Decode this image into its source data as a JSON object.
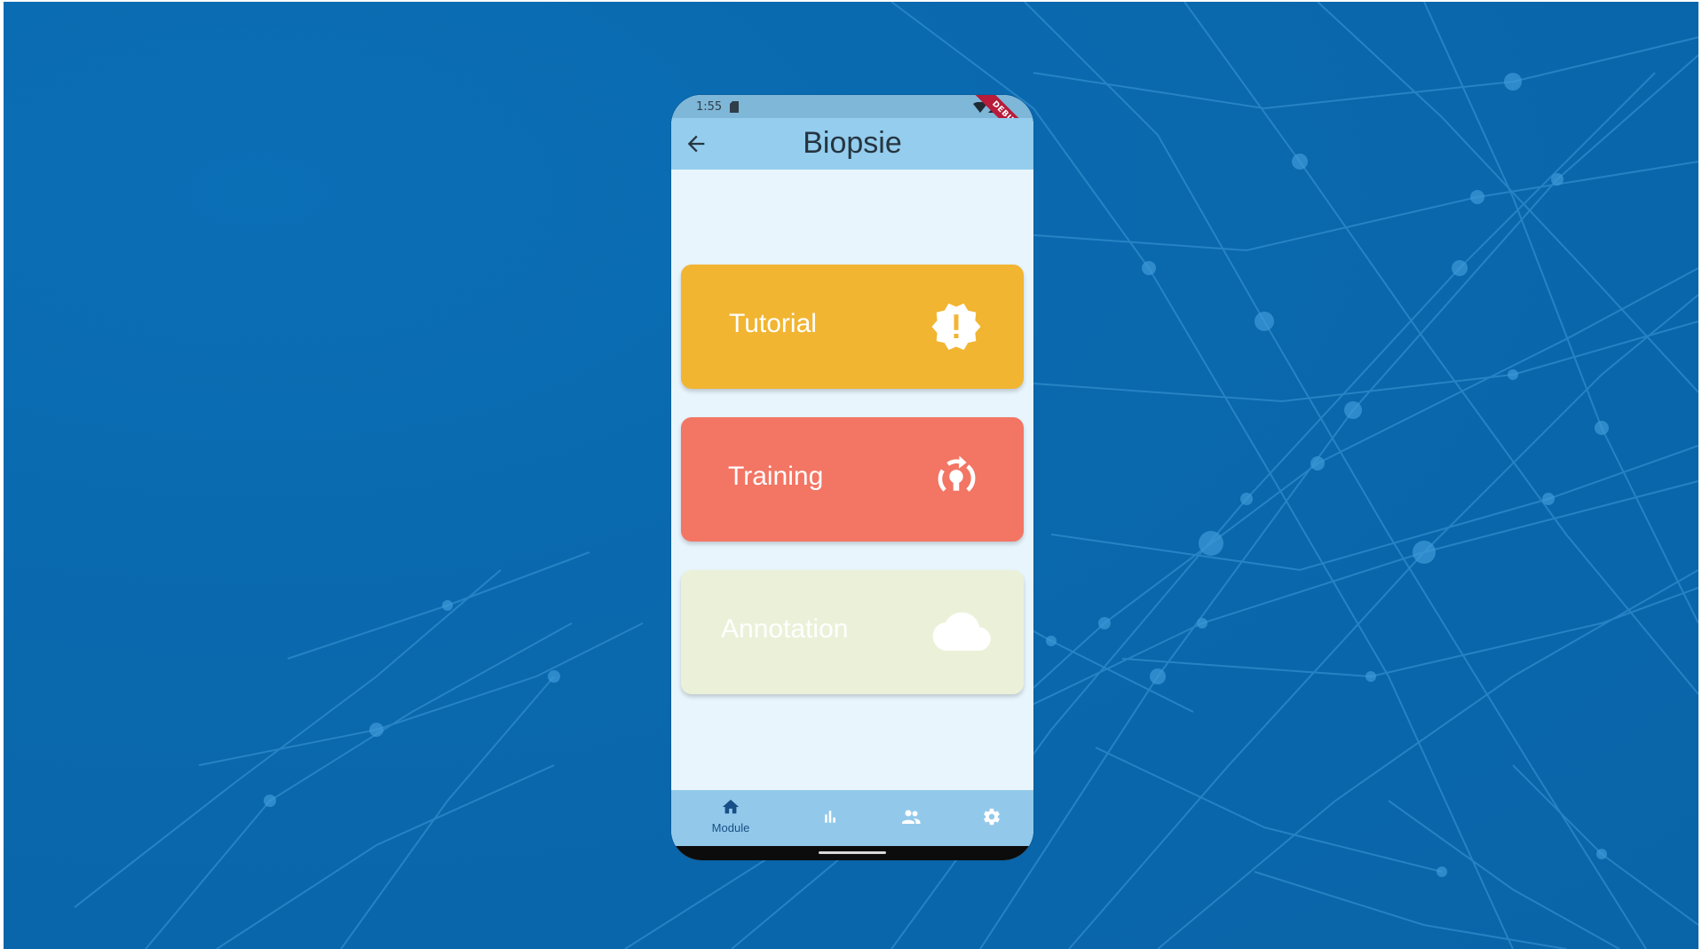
{
  "status_bar": {
    "time": "1:55",
    "debug_label": "DEBUG"
  },
  "app_bar": {
    "title": "Biopsie"
  },
  "modules": [
    {
      "label": "Tutorial",
      "icon": "new-releases-icon",
      "color": "#f1b531"
    },
    {
      "label": "Training",
      "icon": "tips-updates-icon",
      "color": "#f37564"
    },
    {
      "label": "Annotation",
      "icon": "cloud-icon",
      "color": "#ebf1d8"
    }
  ],
  "bottom_nav": {
    "items": [
      {
        "icon": "home-icon",
        "label": "Module",
        "active": true
      },
      {
        "icon": "bar-chart-icon",
        "label": ""
      },
      {
        "icon": "people-icon",
        "label": ""
      },
      {
        "icon": "settings-icon",
        "label": ""
      }
    ]
  },
  "colors": {
    "app_bar": "#94cdee",
    "page_background": "#e8f5fd",
    "nav_active": "#174f86",
    "nav_inactive": "#ffffff",
    "backdrop": "#0a68ad"
  }
}
